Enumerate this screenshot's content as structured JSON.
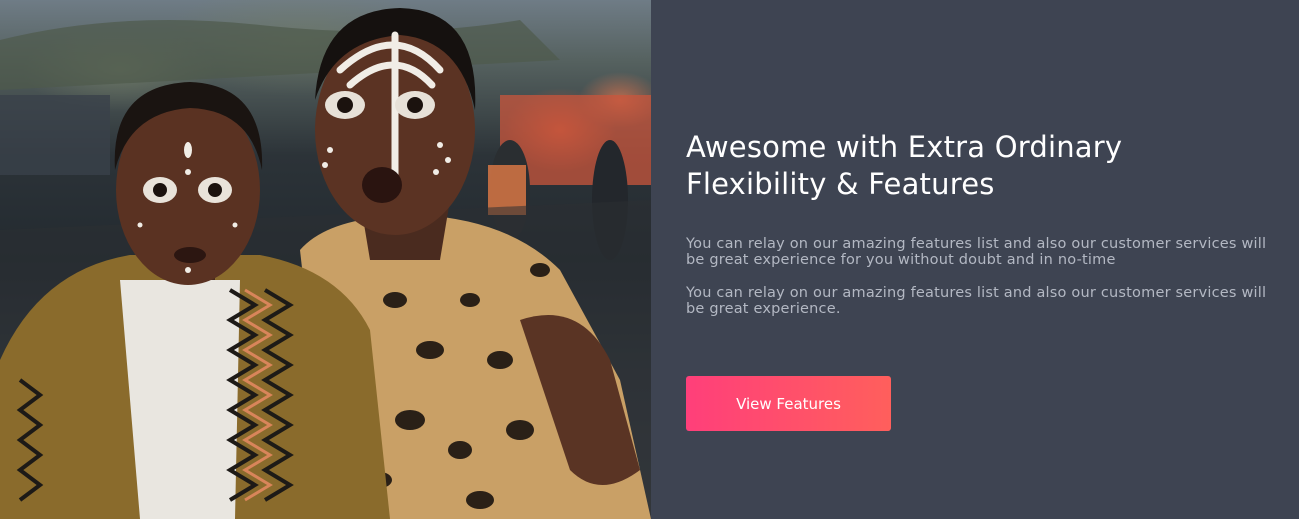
{
  "hero": {
    "image_alt": "Two people with white face paint and patterned garments looking surprised",
    "heading": "Awesome with Extra Ordinary Flexibility & Features",
    "paragraphs": [
      "You can relay on our amazing features list and also our customer services will be great experience for you without doubt and in no-time",
      "You can relay on our amazing features list and also our customer services will be great experience."
    ],
    "cta_label": "View Features"
  },
  "colors": {
    "background": "#3e4452",
    "heading": "#ffffff",
    "body_text": "#b3b8c3",
    "button_start": "#ff3f7a",
    "button_end": "#ff5f5c"
  }
}
